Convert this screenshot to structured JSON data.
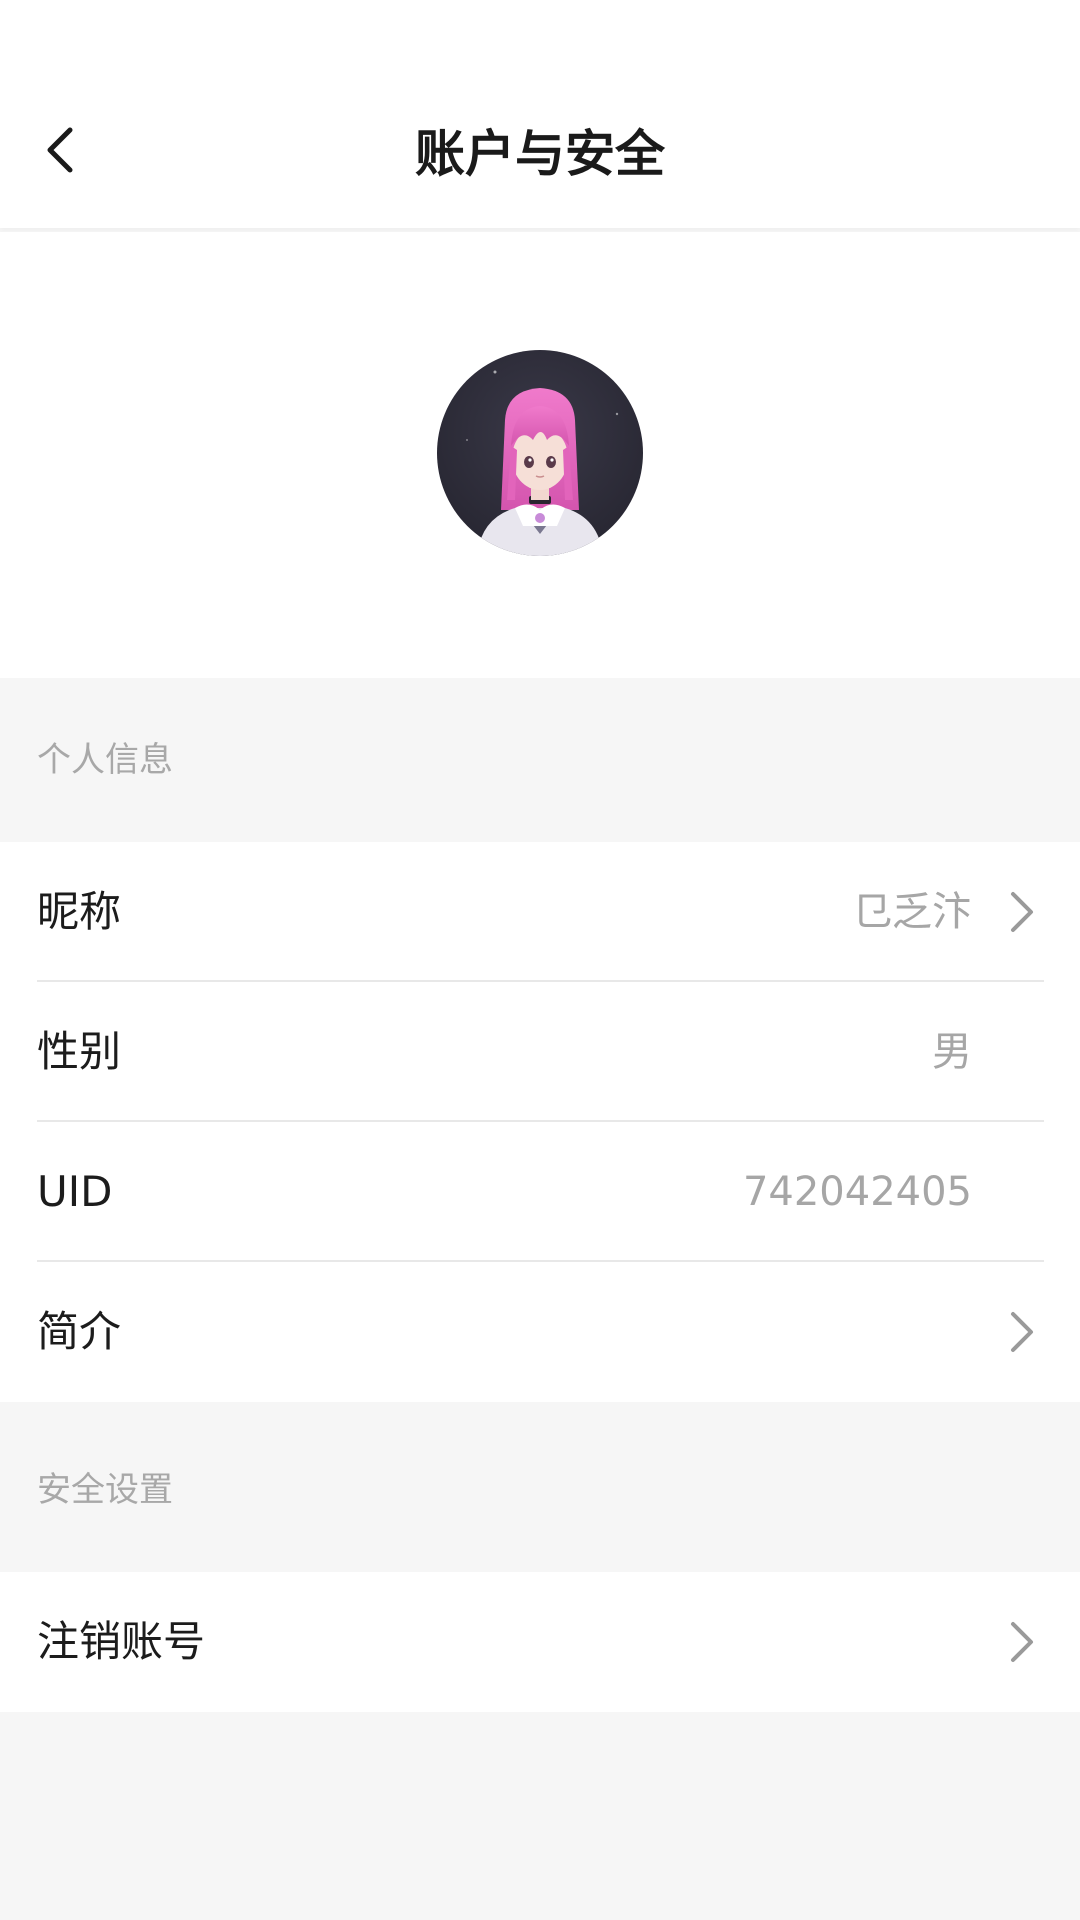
{
  "header": {
    "title": "账户与安全",
    "back_icon": "chevron-left-icon"
  },
  "avatar": {
    "icon": "avatar-anime-girl",
    "bg_color": "#2e2d3a",
    "hair_color": "#e86bc2"
  },
  "sections": {
    "personal": {
      "title": "个人信息"
    },
    "security": {
      "title": "安全设置"
    }
  },
  "personal_rows": {
    "nickname": {
      "label": "昵称",
      "value": "㔾乏汴",
      "has_chevron": true
    },
    "gender": {
      "label": "性别",
      "value": "男",
      "has_chevron": false
    },
    "uid": {
      "label": "UID",
      "value": "742042405",
      "has_chevron": false
    },
    "bio": {
      "label": "简介",
      "value": "",
      "has_chevron": true
    }
  },
  "security_rows": {
    "deactivate": {
      "label": "注销账号",
      "has_chevron": true
    }
  },
  "colors": {
    "page_bg": "#f6f6f6",
    "card_bg": "#ffffff",
    "text_primary": "#1c1c1c",
    "text_secondary": "#a6a6a6",
    "chevron": "#9a9a9a"
  }
}
